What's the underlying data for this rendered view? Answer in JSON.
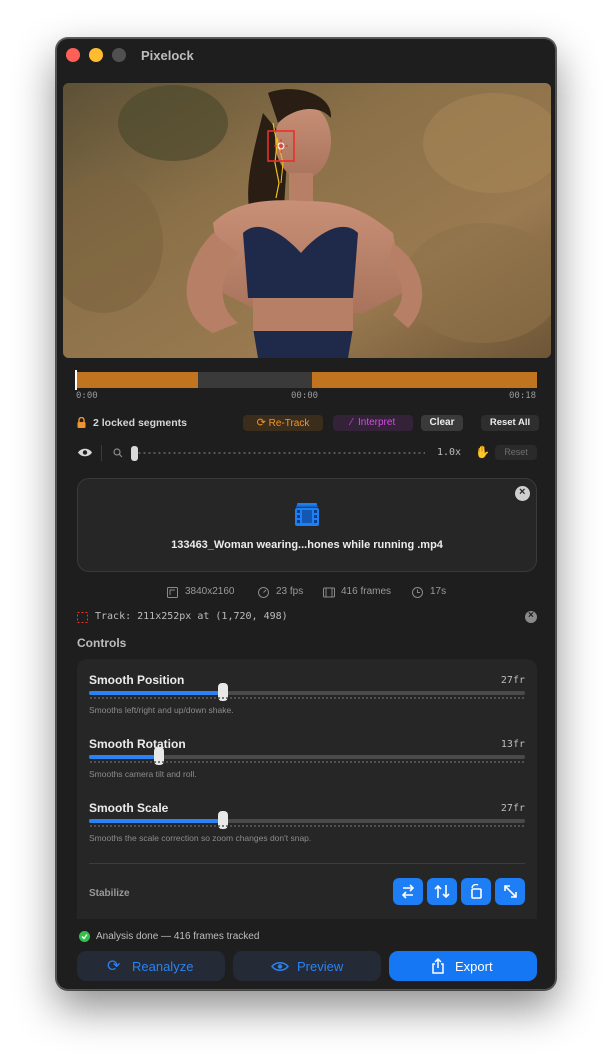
{
  "window": {
    "title": "Pixelock"
  },
  "video": {
    "description_icon": "tracking-box-overlay"
  },
  "timeline": {
    "start_time": "0:00",
    "mid_time": "00:00",
    "end_time": "00:18",
    "segment_color": "#c1741f",
    "gap_color": "#3a3a3a"
  },
  "segments": {
    "locked_label": "2 locked segments",
    "retrack_label": "Re-Track",
    "interpret_label": "Interpret",
    "clear_label": "Clear",
    "reset_all_label": "Reset All"
  },
  "zoom": {
    "value": "1.0x",
    "reset_label": "Reset",
    "level": 0.0
  },
  "file": {
    "name": "133463_Woman wearing...hones while running .mp4",
    "icon": "film-icon"
  },
  "meta": {
    "resolution": "3840x2160",
    "fps": "23 fps",
    "frames": "416 frames",
    "duration": "17s"
  },
  "track": {
    "text": "Track: 211x252px at (1,720, 498)"
  },
  "controls": {
    "heading": "Controls",
    "items": [
      {
        "name": "Smooth Position",
        "value": "27fr",
        "level": 0.307,
        "description": "Smooths left/right and up/down shake."
      },
      {
        "name": "Smooth Rotation",
        "value": "13fr",
        "level": 0.161,
        "description": "Smooths camera tilt and roll."
      },
      {
        "name": "Smooth Scale",
        "value": "27fr",
        "level": 0.307,
        "description": "Smooths the scale correction so zoom changes don't snap."
      }
    ],
    "stabilize_label": "Stabilize"
  },
  "footer": {
    "status": "Analysis done — 416 frames tracked",
    "reanalyze_label": "Reanalyze",
    "preview_label": "Preview",
    "export_label": "Export"
  },
  "colors": {
    "accent": "#1d7ef5",
    "orange": "#f0952e",
    "purple": "#d24de0",
    "success": "#33c14e"
  }
}
